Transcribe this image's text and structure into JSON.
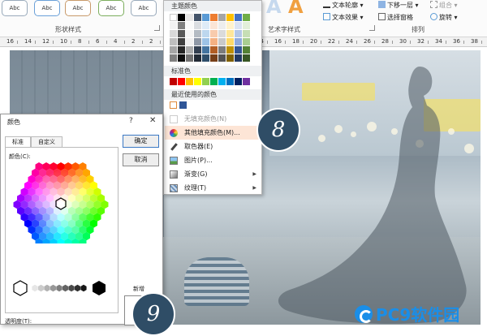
{
  "ribbon": {
    "shape_style_thumb": "Abc",
    "shape_styles_group": "形状样式",
    "wordart_group": "艺术字样式",
    "arrange_group": "排列",
    "text_outline": "文本轮廓",
    "text_effects": "文本效果",
    "send_backward": "下移一层",
    "selection_pane": "选择窗格",
    "group": "组合",
    "rotate": "旋转",
    "wordart_colors": [
      "#c6d9ee",
      "#f0a040"
    ]
  },
  "ruler": {
    "labels": [
      "16",
      "14",
      "12",
      "10",
      "8",
      "6",
      "4",
      "2",
      "2",
      "4",
      "6",
      "8",
      "10",
      "12",
      "14",
      "16",
      "18",
      "20",
      "22",
      "24",
      "26",
      "28",
      "30",
      "32",
      "34",
      "36",
      "38"
    ]
  },
  "color_menu": {
    "theme_header": "主题颜色",
    "standard_header": "标准色",
    "recent_header": "最近使用的颜色",
    "theme_top_row": [
      "#ffffff",
      "#000000",
      "#e7e6e6",
      "#44546a",
      "#5b9bd5",
      "#ed7d31",
      "#a5a5a5",
      "#ffc000",
      "#4472c4",
      "#70ad47"
    ],
    "standard_colors": [
      "#c00000",
      "#ff0000",
      "#ffc000",
      "#ffff00",
      "#92d050",
      "#00b050",
      "#00b0f0",
      "#0070c0",
      "#002060",
      "#7030a0"
    ],
    "recent_colors": [
      "#ffffff",
      "#2f5597"
    ],
    "items": [
      {
        "label": "无填充颜色(N)",
        "icon": "no-fill-icon",
        "disabled": true
      },
      {
        "label": "其他填充颜色(M)...",
        "icon": "palette-icon",
        "highlighted": true
      },
      {
        "label": "取色器(E)",
        "icon": "eyedropper-icon"
      },
      {
        "label": "图片(P)...",
        "icon": "picture-icon"
      },
      {
        "label": "渐变(G)",
        "icon": "gradient-icon",
        "submenu": true
      },
      {
        "label": "纹理(T)",
        "icon": "texture-icon",
        "submenu": true
      }
    ]
  },
  "steps": {
    "step_8": "8",
    "step_9": "9"
  },
  "dialog": {
    "title": "颜色",
    "help": "?",
    "close": "✕",
    "tabs": [
      "标准",
      "自定义"
    ],
    "colors_label": "颜色(C):",
    "ok": "确定",
    "cancel": "取消",
    "new_label": "新增",
    "transparency_label": "透明度(T):"
  },
  "watermark": {
    "text": "PC9软件园"
  }
}
